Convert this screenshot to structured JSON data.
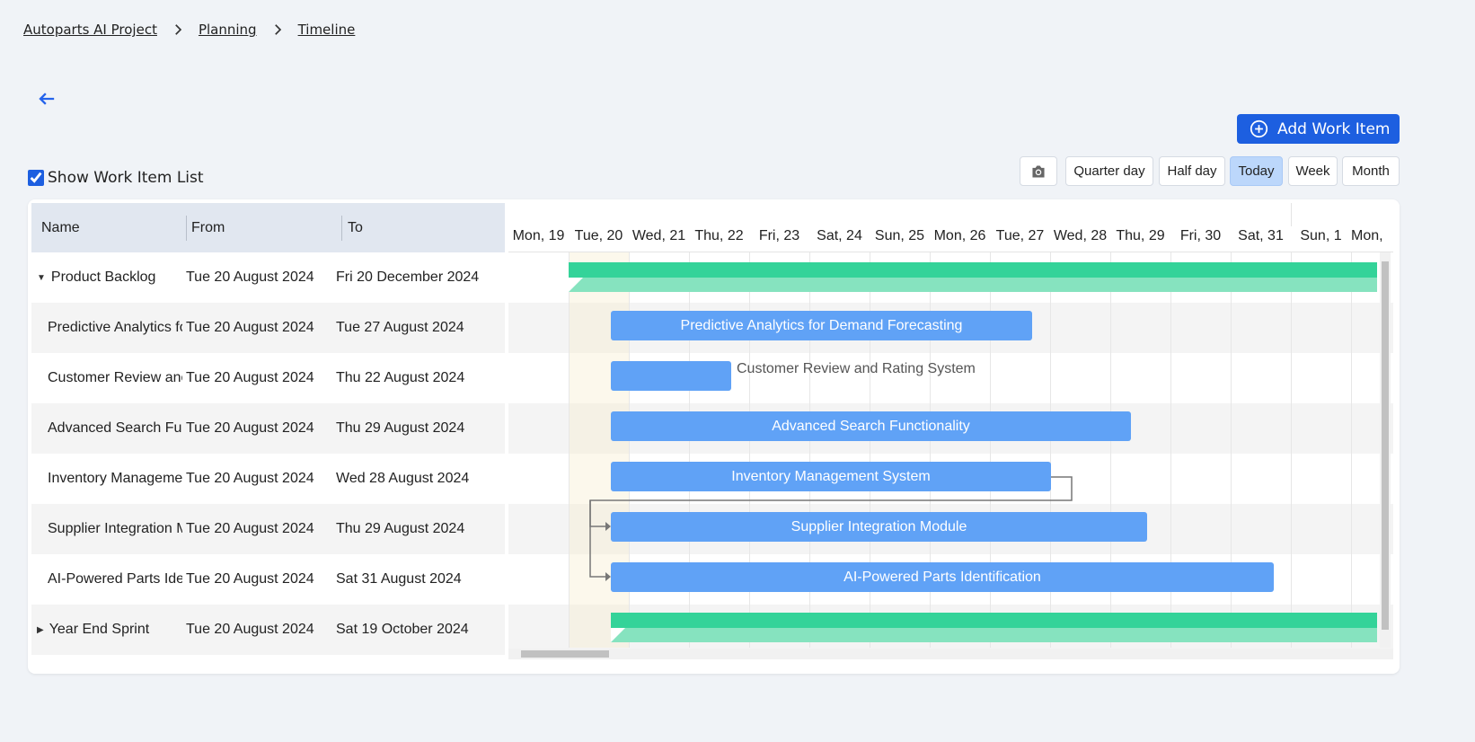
{
  "breadcrumb": {
    "project": "Autoparts AI Project",
    "section": "Planning",
    "page": "Timeline"
  },
  "toolbar": {
    "add_label": "Add Work Item",
    "show_list_label": "Show Work Item List",
    "show_list_checked": true,
    "views": [
      "Quarter day",
      "Half day",
      "Today",
      "Week",
      "Month"
    ],
    "active_view": "Today",
    "screenshot_icon": "camera-icon",
    "back_icon": "arrow-left-icon"
  },
  "grid": {
    "headers": {
      "name": "Name",
      "from": "From",
      "to": "To"
    },
    "rows": [
      {
        "name": "Product Backlog",
        "from": "Tue 20 August 2024",
        "to": "Fri 20 December 2024",
        "type": "project",
        "expanded": true
      },
      {
        "name": "Predictive Analytics fo",
        "from": "Tue 20 August 2024",
        "to": "Tue 27 August 2024",
        "type": "task"
      },
      {
        "name": "Customer Review anc",
        "from": "Tue 20 August 2024",
        "to": "Thu 22 August 2024",
        "type": "task"
      },
      {
        "name": "Advanced Search Fur",
        "from": "Tue 20 August 2024",
        "to": "Thu 29 August 2024",
        "type": "task"
      },
      {
        "name": "Inventory Managemer",
        "from": "Tue 20 August 2024",
        "to": "Wed 28 August 2024",
        "type": "task"
      },
      {
        "name": "Supplier Integration M",
        "from": "Tue 20 August 2024",
        "to": "Thu 29 August 2024",
        "type": "task"
      },
      {
        "name": "AI-Powered Parts Ider",
        "from": "Tue 20 August 2024",
        "to": "Sat 31 August 2024",
        "type": "task"
      },
      {
        "name": "Year End Sprint",
        "from": "Tue 20 August 2024",
        "to": "Sat 19 October 2024",
        "type": "project",
        "expanded": false
      }
    ]
  },
  "timeline": {
    "days": [
      "Mon, 19",
      "Tue, 20",
      "Wed, 21",
      "Thu, 22",
      "Fri, 23",
      "Sat, 24",
      "Sun, 25",
      "Mon, 26",
      "Tue, 27",
      "Wed, 28",
      "Thu, 29",
      "Fri, 30",
      "Sat, 31",
      "Sun, 1",
      "Mon,"
    ],
    "bars": [
      {
        "label": "",
        "start_day": "Tue, 20",
        "end_day": "Fri 20 December 2024",
        "kind": "project"
      },
      {
        "label": "Predictive Analytics for Demand Forecasting",
        "kind": "task",
        "label_inside": true
      },
      {
        "label": "Customer Review and Rating System",
        "kind": "task",
        "label_inside": false
      },
      {
        "label": "Advanced Search Functionality",
        "kind": "task",
        "label_inside": true
      },
      {
        "label": "Inventory Management System",
        "kind": "task",
        "label_inside": true
      },
      {
        "label": "Supplier Integration Module",
        "kind": "task",
        "label_inside": true
      },
      {
        "label": "AI-Powered Parts Identification",
        "kind": "task",
        "label_inside": true
      },
      {
        "label": "",
        "kind": "project"
      }
    ]
  },
  "colors": {
    "accent": "#1d5fe0",
    "task_bar": "#60a2f6",
    "project_bar": "#34d399",
    "active_view": "#bcd7fb"
  }
}
